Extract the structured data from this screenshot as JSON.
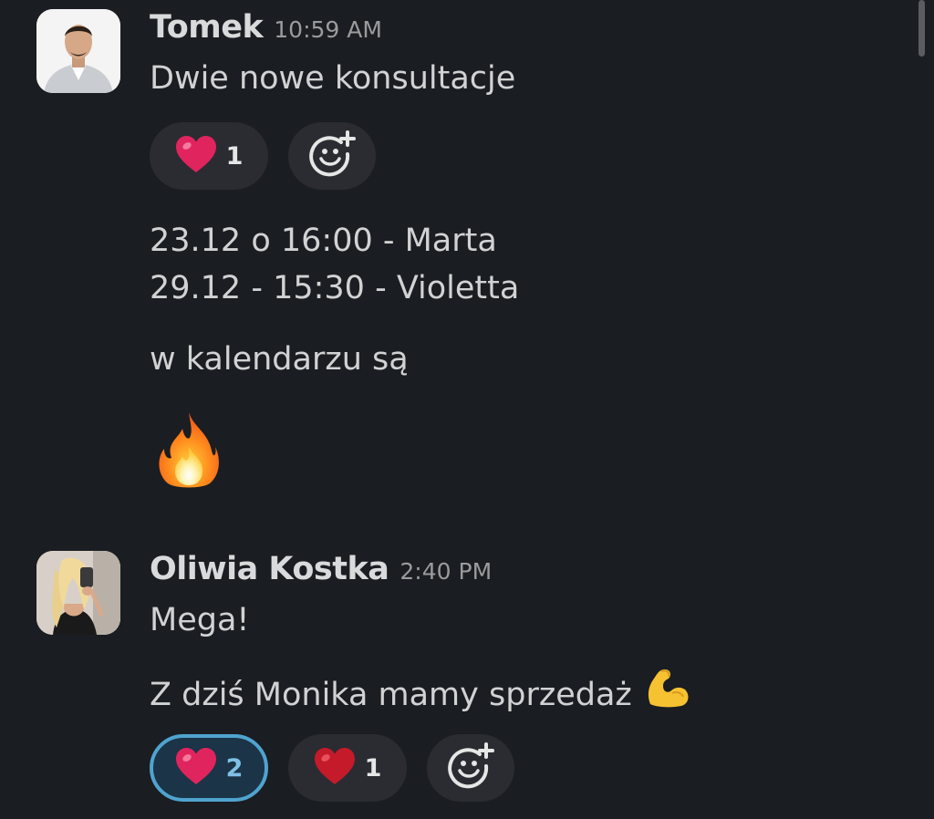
{
  "messages": [
    {
      "sender": "Tomek",
      "time": "10:59 AM",
      "line1": "Dwie nowe konsultacje",
      "reactions": [
        {
          "emoji": "heart-icon",
          "count": "1"
        }
      ],
      "line2": "23.12 o 16:00 - Marta",
      "line3": "29.12 - 15:30 - Violetta",
      "line4": "w kalendarzu są",
      "big_emoji": "fire-icon"
    },
    {
      "sender": "Oliwia Kostka",
      "time": "2:40 PM",
      "line1": "Mega!",
      "line2": "Z dziś Monika mamy sprzedaż",
      "line2_emoji": "flexed-biceps-icon",
      "reactions": [
        {
          "emoji": "heart-icon",
          "count": "2",
          "active": true
        },
        {
          "emoji": "heart-icon",
          "count": "1"
        }
      ]
    }
  ],
  "colors": {
    "background": "#1a1d21",
    "reaction_bg": "#2a2c31",
    "reaction_active_border": "#4fa3cf",
    "heart": "#e0245e"
  }
}
